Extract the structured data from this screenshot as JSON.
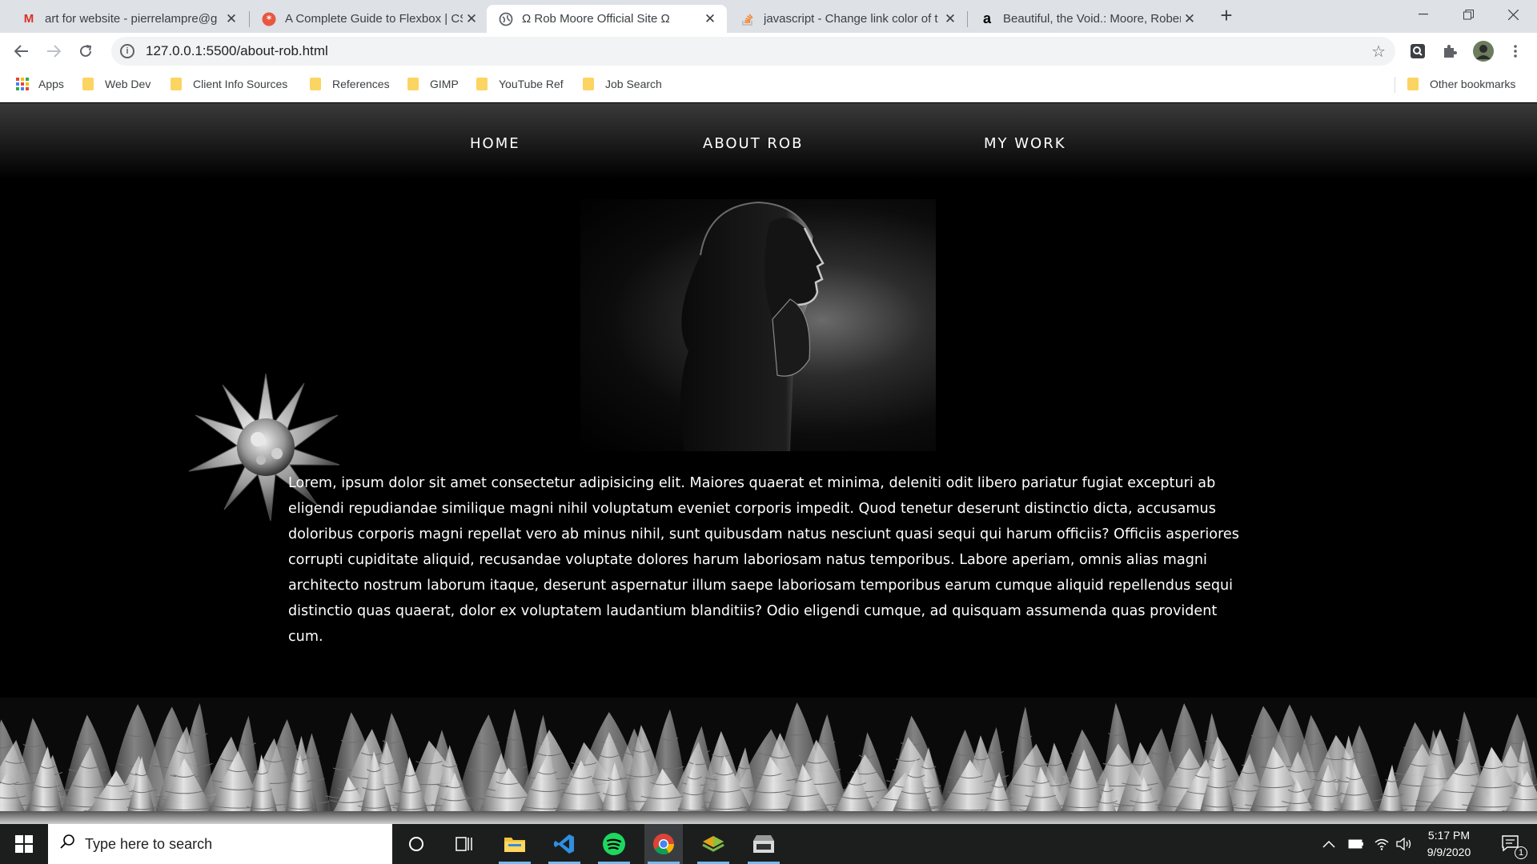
{
  "browser": {
    "tabs": [
      {
        "title": "art for website - pierrelampre@g",
        "icon": "gmail-icon"
      },
      {
        "title": "A Complete Guide to Flexbox | CS",
        "icon": "css-tricks-icon"
      },
      {
        "title": "Ω Rob Moore Official Site Ω",
        "icon": "globe-icon"
      },
      {
        "title": "javascript - Change link color of t",
        "icon": "stackoverflow-icon"
      },
      {
        "title": "Beautiful, the Void.: Moore, Rober",
        "icon": "amazon-icon"
      }
    ],
    "url": "127.0.0.1:5500/about-rob.html",
    "bookmarks": [
      "Apps",
      "Web Dev",
      "Client Info Sources",
      "References",
      "GIMP",
      "YouTube Ref",
      "Job Search"
    ],
    "other_bookmarks": "Other bookmarks"
  },
  "site": {
    "nav": [
      "HOME",
      "ABOUT ROB",
      "MY WORK"
    ],
    "bio": "Lorem, ipsum dolor sit amet consectetur adipisicing elit. Maiores quaerat et minima, deleniti odit libero pariatur fugiat excepturi ab eligendi repudiandae similique magni nihil voluptatum eveniet corporis impedit. Quod tenetur deserunt distinctio dicta, accusamus doloribus corporis magni repellat vero ab minus nihil, sunt quibusdam natus nesciunt quasi sequi qui harum officiis? Officiis asperiores corrupti cupiditate aliquid, recusandae voluptate dolores harum laboriosam natus temporibus. Labore aperiam, omnis alias magni architecto nostrum laborum itaque, deserunt aspernatur illum saepe laboriosam temporibus earum cumque aliquid repellendus sequi distinctio quas quaerat, dolor ex voluptatem laudantium blanditiis? Odio eligendi cumque, ad quisquam assumenda quas provident cum."
  },
  "taskbar": {
    "search_placeholder": "Type here to search",
    "time": "5:17 PM",
    "date": "9/9/2020",
    "notification_count": "1"
  }
}
